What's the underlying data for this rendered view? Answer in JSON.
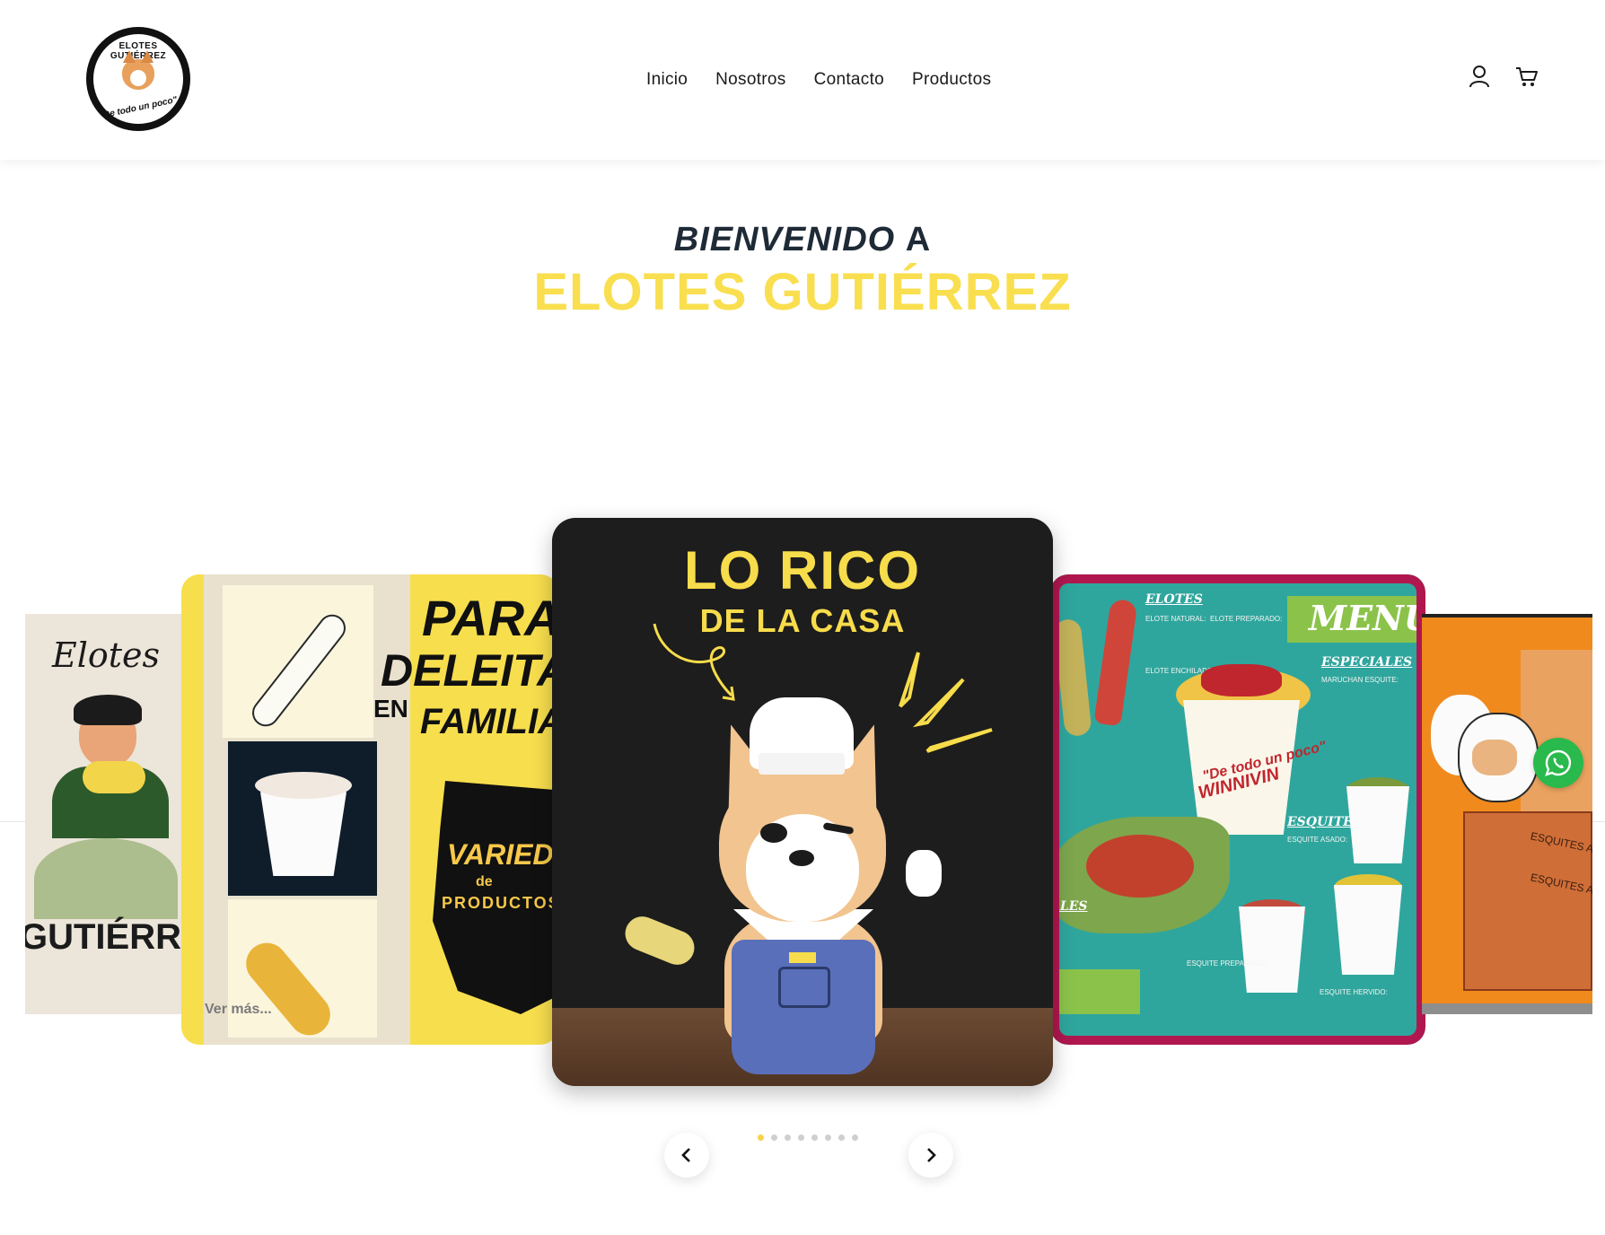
{
  "header": {
    "logo": {
      "top_text": "ELOTES GUTIÉRREZ",
      "bottom_text": "\"De todo un poco\""
    },
    "nav": [
      {
        "label": "Inicio"
      },
      {
        "label": "Nosotros"
      },
      {
        "label": "Contacto"
      },
      {
        "label": "Productos"
      }
    ],
    "icons": [
      "user-icon",
      "cart-icon"
    ]
  },
  "hero": {
    "welcome": "BIENVENIDO",
    "welcome_a": "A",
    "brand": "ELOTES GUTIÉRREZ"
  },
  "carousel": {
    "slides": {
      "far_left": {
        "title": "Elotes",
        "bottom": "GUTIÉRREZ"
      },
      "left": {
        "para": "PARA",
        "deleitar": "DELEITAR",
        "en": "EN",
        "familia": "FAMILIA",
        "variedad": "VARIEDAD",
        "de": "de",
        "productos": "PRODUCTOS",
        "ver_mas": "Ver más..."
      },
      "center": {
        "title1": "LO RICO",
        "title2": "DE LA CASA"
      },
      "right": {
        "menu": "MENÚ",
        "elotes": "ELOTES",
        "especiales": "ESPECIALES",
        "esquites": "ESQUITES",
        "ales": "ALES",
        "cup_line1": "\"De todo un poco\"",
        "cup_line2": "WINNIVIN",
        "elote_natural": "ELOTE NATURAL:",
        "elote_preparado": "ELOTE PREPARADO:",
        "elote_enchilado": "ELOTE ENCHILADO:",
        "maruchan": "MARUCHAN ESQUITE:",
        "esquite_asado": "ESQUITE ASADO:",
        "esquite_preparado": "ESQUITE PREPARADO:",
        "esquite_hervido": "ESQUITE HERVIDO:"
      },
      "far_right": {
        "label1": "ESQUITES ASADOS",
        "label2": "ESQUITES ASADOS"
      }
    },
    "dots_count": 8,
    "active_dot": 0,
    "prev_icon": "chevron-left-icon",
    "next_icon": "chevron-right-icon"
  },
  "whatsapp": {
    "icon": "whatsapp-icon"
  },
  "colors": {
    "brand_yellow": "#f9df4f",
    "welcome_dark": "#1e2a36",
    "whatsapp_green": "#29b94c"
  }
}
